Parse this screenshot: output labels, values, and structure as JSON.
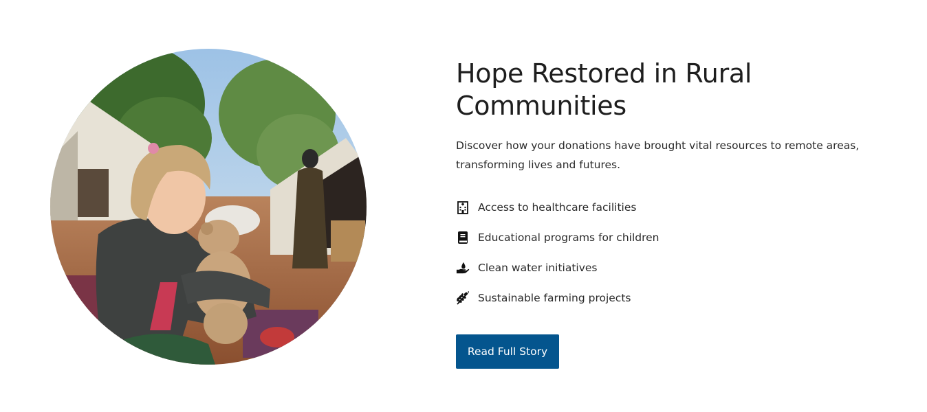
{
  "story": {
    "title": "Hope Restored in Rural Communities",
    "description": "Discover how your donations have brought vital resources to remote areas, transforming lives and futures.",
    "image_alt": "Child holding a teddy bear in a rural camp",
    "features": [
      {
        "label": "Access to healthcare facilities",
        "icon": "hospital-icon"
      },
      {
        "label": "Educational programs for children",
        "icon": "book-icon"
      },
      {
        "label": "Clean water initiatives",
        "icon": "hand-water-drop-icon"
      },
      {
        "label": "Sustainable farming projects",
        "icon": "wheat-icon"
      }
    ],
    "cta_label": "Read Full Story"
  },
  "colors": {
    "accent": "#04558e",
    "text": "#1e1e1e",
    "background": "#ffffff"
  }
}
